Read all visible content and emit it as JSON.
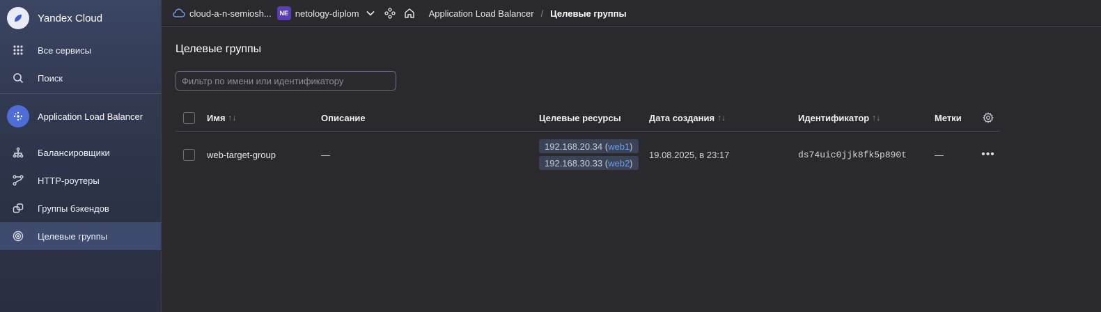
{
  "sidebar": {
    "brand": "Yandex Cloud",
    "top_items": [
      {
        "label": "Все сервисы",
        "icon": "grid-icon"
      },
      {
        "label": "Поиск",
        "icon": "search-icon"
      }
    ],
    "service": {
      "label": "Application Load Balancer",
      "icon": "alb-icon"
    },
    "items": [
      {
        "label": "Балансировщики",
        "icon": "balancer-icon"
      },
      {
        "label": "HTTP-роутеры",
        "icon": "router-icon"
      },
      {
        "label": "Группы бэкендов",
        "icon": "backend-groups-icon"
      },
      {
        "label": "Целевые группы",
        "icon": "target-icon",
        "active": true
      }
    ]
  },
  "topbar": {
    "cloud": "cloud-a-n-semiosh...",
    "folder_badge": "NE",
    "folder": "netology-diplom",
    "breadcrumb": [
      "Application Load Balancer",
      "Целевые группы"
    ]
  },
  "main": {
    "title": "Целевые группы",
    "filter_placeholder": "Фильтр по имени или идентификатору",
    "columns": [
      "Имя",
      "Описание",
      "Целевые ресурсы",
      "Дата создания",
      "Идентификатор",
      "Метки"
    ],
    "rows": [
      {
        "name": "web-target-group",
        "description": "—",
        "resources": [
          {
            "ip": "192.168.20.34",
            "name": "web1"
          },
          {
            "ip": "192.168.30.33",
            "name": "web2"
          }
        ],
        "created": "19.08.2025, в 23:17",
        "id": "ds74uic0jjk8fk5p890t",
        "tags": "—"
      }
    ]
  }
}
